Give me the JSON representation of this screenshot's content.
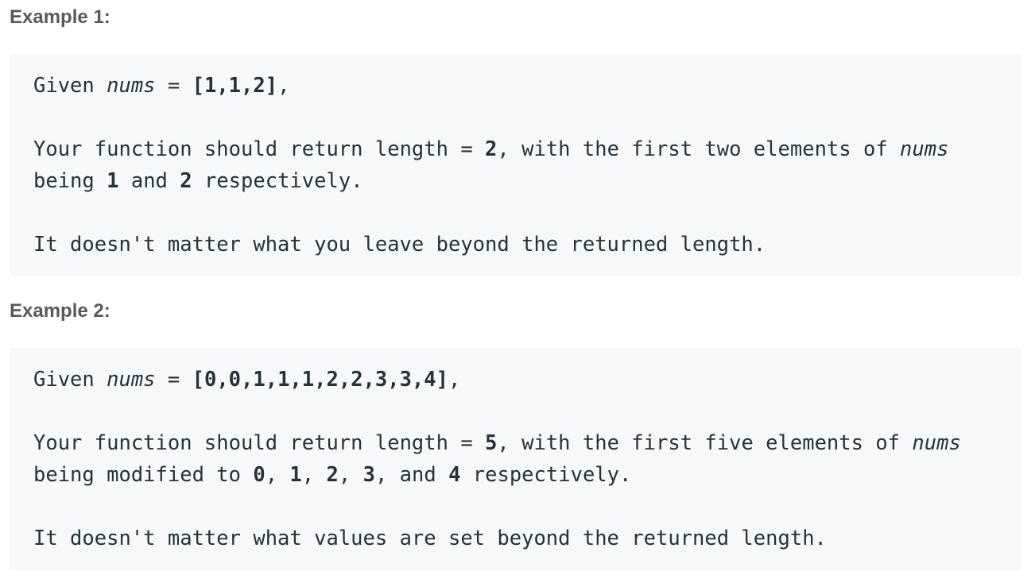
{
  "example1": {
    "heading": "Example 1:",
    "given_prefix": "Given ",
    "given_var": "nums",
    "given_eq": " = ",
    "given_value": "[1,1,2]",
    "given_suffix": ",",
    "line2_a": "Your function should return length = ",
    "line2_len": "2",
    "line2_b": ", with the first two elements of ",
    "line2_var": "nums",
    "line3_a": "being ",
    "line3_v1": "1",
    "line3_b": " and ",
    "line3_v2": "2",
    "line3_c": " respectively.",
    "line4": "It doesn't matter what you leave beyond the returned length."
  },
  "example2": {
    "heading": "Example 2:",
    "given_prefix": "Given ",
    "given_var": "nums",
    "given_eq": " = ",
    "given_value": "[0,0,1,1,1,2,2,3,3,4]",
    "given_suffix": ",",
    "line2_a": "Your function should return length = ",
    "line2_len": "5",
    "line2_b": ", with the first five elements of ",
    "line2_var": "nums",
    "line3_a": "being modified to ",
    "line3_v1": "0",
    "line3_s1": ", ",
    "line3_v2": "1",
    "line3_s2": ", ",
    "line3_v3": "2",
    "line3_s3": ", ",
    "line3_v4": "3",
    "line3_s4": ", and ",
    "line3_v5": "4",
    "line3_c": " respectively.",
    "line4": "It doesn't matter what values are set beyond the returned length."
  }
}
